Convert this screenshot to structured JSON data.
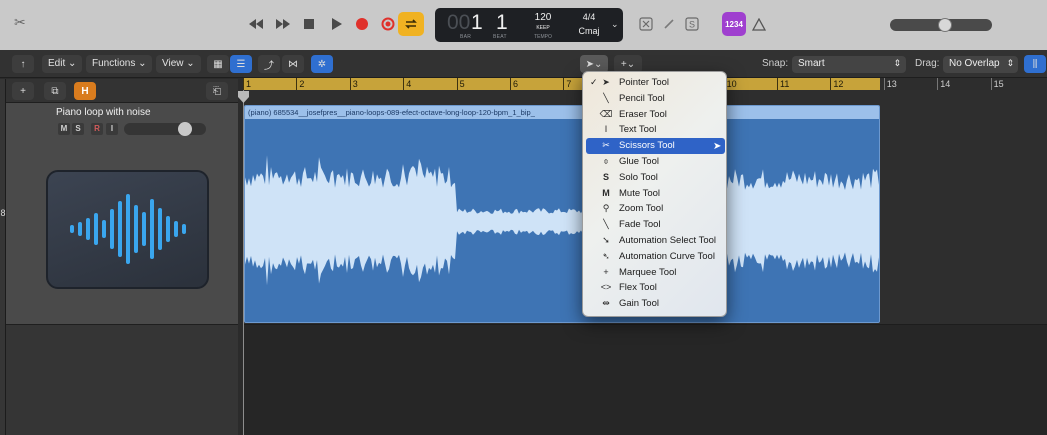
{
  "transport": {
    "display": {
      "bar_dim": "00",
      "bar": "1",
      "beat": "1",
      "bar_caption": "BAR",
      "beat_caption": "BEAT",
      "tempo": "120",
      "keep": "KEEP",
      "tempo_caption": "TEMPO",
      "time_signature": "4/4",
      "key": "Cmaj"
    },
    "badge": "1234",
    "master_volume": 0.55,
    "colors": {
      "record": "#e0312b",
      "cycle": "#f0b222",
      "badge": "#9f3fcf"
    }
  },
  "toolbar": {
    "edit_label": "Edit",
    "functions_label": "Functions",
    "view_label": "View",
    "snap_label": "Snap:",
    "snap_value": "Smart",
    "drag_label": "Drag:",
    "drag_value": "No Overlap",
    "icons": [
      "back-arrow-icon",
      "grid-view-icon",
      "list-view-icon",
      "automation-icon",
      "crossfade-icon",
      "catch-icon",
      "pointer-tool-icon",
      "marquee-tool-icon",
      "waveform-icon"
    ]
  },
  "track_header": {
    "add_label": "+",
    "h_label": "H",
    "track_number": "8",
    "track_name": "Piano loop with noise",
    "mute": "M",
    "solo": "S",
    "record": "R",
    "input": "I",
    "volume": 0.8,
    "icon": "audio-waveform-icon"
  },
  "ruler": {
    "bars": [
      "1",
      "2",
      "3",
      "4",
      "5",
      "6",
      "7",
      "8",
      "9",
      "10",
      "11",
      "12",
      "13",
      "14",
      "15"
    ]
  },
  "region": {
    "title": "(piano) 685534__josefpres__piano-loops-089-efect-octave-long-loop-120-bpm_1_bip_",
    "color": "#3e74b4"
  },
  "tool_menu": {
    "selected": "Scissors Tool",
    "items": [
      {
        "label": "Pointer Tool",
        "icon": "pointer-icon",
        "checked": true
      },
      {
        "label": "Pencil Tool",
        "icon": "pencil-icon"
      },
      {
        "label": "Eraser Tool",
        "icon": "eraser-icon"
      },
      {
        "label": "Text Tool",
        "icon": "text-cursor-icon"
      },
      {
        "label": "Scissors Tool",
        "icon": "scissors-icon"
      },
      {
        "label": "Glue Tool",
        "icon": "glue-icon"
      },
      {
        "label": "Solo Tool",
        "icon": "solo-icon"
      },
      {
        "label": "Mute Tool",
        "icon": "mute-icon"
      },
      {
        "label": "Zoom Tool",
        "icon": "zoom-icon"
      },
      {
        "label": "Fade Tool",
        "icon": "fade-icon"
      },
      {
        "label": "Automation Select Tool",
        "icon": "automation-select-icon"
      },
      {
        "label": "Automation Curve Tool",
        "icon": "automation-curve-icon"
      },
      {
        "label": "Marquee Tool",
        "icon": "marquee-icon"
      },
      {
        "label": "Flex Tool",
        "icon": "flex-icon"
      },
      {
        "label": "Gain Tool",
        "icon": "gain-icon"
      }
    ]
  }
}
